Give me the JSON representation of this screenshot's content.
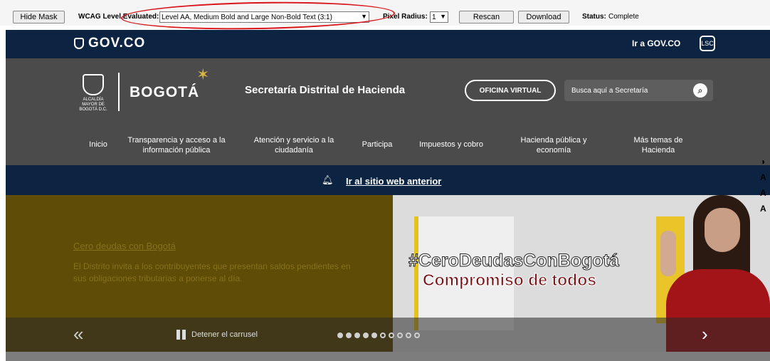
{
  "toolbar": {
    "hide_mask": "Hide Mask",
    "wcag_label": "WCAG Level Evaluated:",
    "wcag_value": "Level AA, Medium Bold and Large Non-Bold Text (3:1)",
    "pixel_radius_label": "Pixel Radius:",
    "pixel_radius_value": "1",
    "rescan": "Rescan",
    "download": "Download",
    "status_label": "Status:",
    "status_value": "Complete"
  },
  "govbar": {
    "logo": "GOV.CO",
    "link": "Ir a GOV.CO",
    "accessibility": "LSC"
  },
  "header": {
    "escudo_text": "ALCALDÍA MAYOR DE BOGOTÁ D.C.",
    "city": "BOGOTÁ",
    "entity": "Secretaría Distrital de Hacienda",
    "oficina": "OFICINA VIRTUAL",
    "search_placeholder": "Busca aquí a Secretaría"
  },
  "nav": [
    {
      "label": "Inicio"
    },
    {
      "label": "Transparencia y acceso a la información pública"
    },
    {
      "label": "Atención y servicio a la ciudadanía"
    },
    {
      "label": "Participa"
    },
    {
      "label": "Impuestos y cobro"
    },
    {
      "label": "Hacienda pública y economía"
    },
    {
      "label": "Más temas de Hacienda"
    }
  ],
  "notice": {
    "link": "Ir al sitio web anterior"
  },
  "carousel": {
    "slide_title": "Cero deudas con Bogotá",
    "slide_text": "El Distrito invita a los contribuyentes que presentan saldos pendientes en sus obligaciones tributarias a ponerse al día.",
    "hashtag": "#CeroDeudasConBogotá",
    "tagline": "Compromiso de todos",
    "pause_label": "Detener el carrusel",
    "dots_total": 10,
    "dots_filled": 5
  },
  "side_tools": [
    "A",
    "A",
    "A"
  ]
}
